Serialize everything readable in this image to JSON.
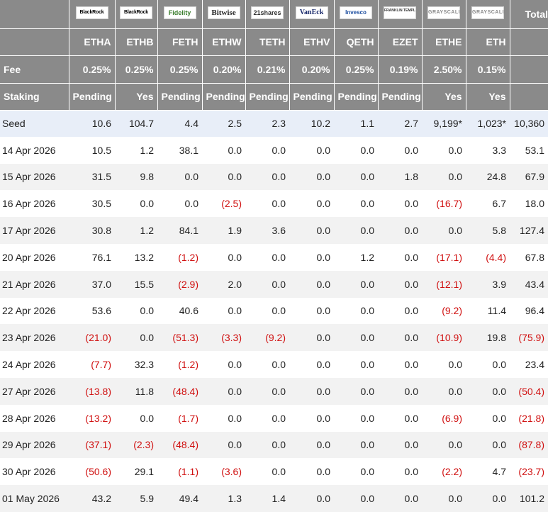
{
  "header": {
    "logos": [
      {
        "name": "BlackRock",
        "style": "blackrock"
      },
      {
        "name": "BlackRock",
        "style": "blackrock"
      },
      {
        "name": "Fidelity",
        "style": "fidelity"
      },
      {
        "name": "Bitwise",
        "style": "bitwise"
      },
      {
        "name": "21shares",
        "style": "shares21"
      },
      {
        "name": "VanEck",
        "style": "vaneck"
      },
      {
        "name": "Invesco",
        "style": "invesco"
      },
      {
        "name": "FRANKLIN TEMPLETON",
        "style": "franklin"
      },
      {
        "name": "GRAYSCALE",
        "style": "grayscale"
      },
      {
        "name": "GRAYSCALE",
        "style": "grayscale"
      }
    ],
    "total_label": "Total",
    "tickers": [
      "ETHA",
      "ETHB",
      "FETH",
      "ETHW",
      "TETH",
      "ETHV",
      "QETH",
      "EZET",
      "ETHE",
      "ETH"
    ],
    "fee_label": "Fee",
    "fees": [
      "0.25%",
      "0.25%",
      "0.25%",
      "0.20%",
      "0.21%",
      "0.20%",
      "0.25%",
      "0.19%",
      "2.50%",
      "0.15%"
    ],
    "staking_label": "Staking",
    "staking": [
      "Pending",
      "Yes",
      "Pending",
      "Pending",
      "Pending",
      "Pending",
      "Pending",
      "Pending",
      "Yes",
      "Yes"
    ]
  },
  "rows": [
    {
      "date": "Seed",
      "values": [
        "10.6",
        "104.7",
        "4.4",
        "2.5",
        "2.3",
        "10.2",
        "1.1",
        "2.7",
        "9,199*",
        "1,023*"
      ],
      "total": "10,360"
    },
    {
      "date": "14 Apr 2026",
      "values": [
        "10.5",
        "1.2",
        "38.1",
        "0.0",
        "0.0",
        "0.0",
        "0.0",
        "0.0",
        "0.0",
        "3.3"
      ],
      "total": "53.1"
    },
    {
      "date": "15 Apr 2026",
      "values": [
        "31.5",
        "9.8",
        "0.0",
        "0.0",
        "0.0",
        "0.0",
        "0.0",
        "1.8",
        "0.0",
        "24.8"
      ],
      "total": "67.9"
    },
    {
      "date": "16 Apr 2026",
      "values": [
        "30.5",
        "0.0",
        "0.0",
        "(2.5)",
        "0.0",
        "0.0",
        "0.0",
        "0.0",
        "(16.7)",
        "6.7"
      ],
      "total": "18.0"
    },
    {
      "date": "17 Apr 2026",
      "values": [
        "30.8",
        "1.2",
        "84.1",
        "1.9",
        "3.6",
        "0.0",
        "0.0",
        "0.0",
        "0.0",
        "5.8"
      ],
      "total": "127.4"
    },
    {
      "date": "20 Apr 2026",
      "values": [
        "76.1",
        "13.2",
        "(1.2)",
        "0.0",
        "0.0",
        "0.0",
        "1.2",
        "0.0",
        "(17.1)",
        "(4.4)"
      ],
      "total": "67.8"
    },
    {
      "date": "21 Apr 2026",
      "values": [
        "37.0",
        "15.5",
        "(2.9)",
        "2.0",
        "0.0",
        "0.0",
        "0.0",
        "0.0",
        "(12.1)",
        "3.9"
      ],
      "total": "43.4"
    },
    {
      "date": "22 Apr 2026",
      "values": [
        "53.6",
        "0.0",
        "40.6",
        "0.0",
        "0.0",
        "0.0",
        "0.0",
        "0.0",
        "(9.2)",
        "11.4"
      ],
      "total": "96.4"
    },
    {
      "date": "23 Apr 2026",
      "values": [
        "(21.0)",
        "0.0",
        "(51.3)",
        "(3.3)",
        "(9.2)",
        "0.0",
        "0.0",
        "0.0",
        "(10.9)",
        "19.8"
      ],
      "total": "(75.9)"
    },
    {
      "date": "24 Apr 2026",
      "values": [
        "(7.7)",
        "32.3",
        "(1.2)",
        "0.0",
        "0.0",
        "0.0",
        "0.0",
        "0.0",
        "0.0",
        "0.0"
      ],
      "total": "23.4"
    },
    {
      "date": "27 Apr 2026",
      "values": [
        "(13.8)",
        "11.8",
        "(48.4)",
        "0.0",
        "0.0",
        "0.0",
        "0.0",
        "0.0",
        "0.0",
        "0.0"
      ],
      "total": "(50.4)"
    },
    {
      "date": "28 Apr 2026",
      "values": [
        "(13.2)",
        "0.0",
        "(1.7)",
        "0.0",
        "0.0",
        "0.0",
        "0.0",
        "0.0",
        "(6.9)",
        "0.0"
      ],
      "total": "(21.8)"
    },
    {
      "date": "29 Apr 2026",
      "values": [
        "(37.1)",
        "(2.3)",
        "(48.4)",
        "0.0",
        "0.0",
        "0.0",
        "0.0",
        "0.0",
        "0.0",
        "0.0"
      ],
      "total": "(87.8)"
    },
    {
      "date": "30 Apr 2026",
      "values": [
        "(50.6)",
        "29.1",
        "(1.1)",
        "(3.6)",
        "0.0",
        "0.0",
        "0.0",
        "0.0",
        "(2.2)",
        "4.7"
      ],
      "total": "(23.7)"
    },
    {
      "date": "01 May 2026",
      "values": [
        "43.2",
        "5.9",
        "49.4",
        "1.3",
        "1.4",
        "0.0",
        "0.0",
        "0.0",
        "0.0",
        "0.0"
      ],
      "total": "101.2"
    }
  ],
  "colors": {
    "header_bg": "#8a8a8a",
    "negative": "#d01010",
    "seed_row": "#e8eef8",
    "alt_row": "#f2f2f2"
  }
}
